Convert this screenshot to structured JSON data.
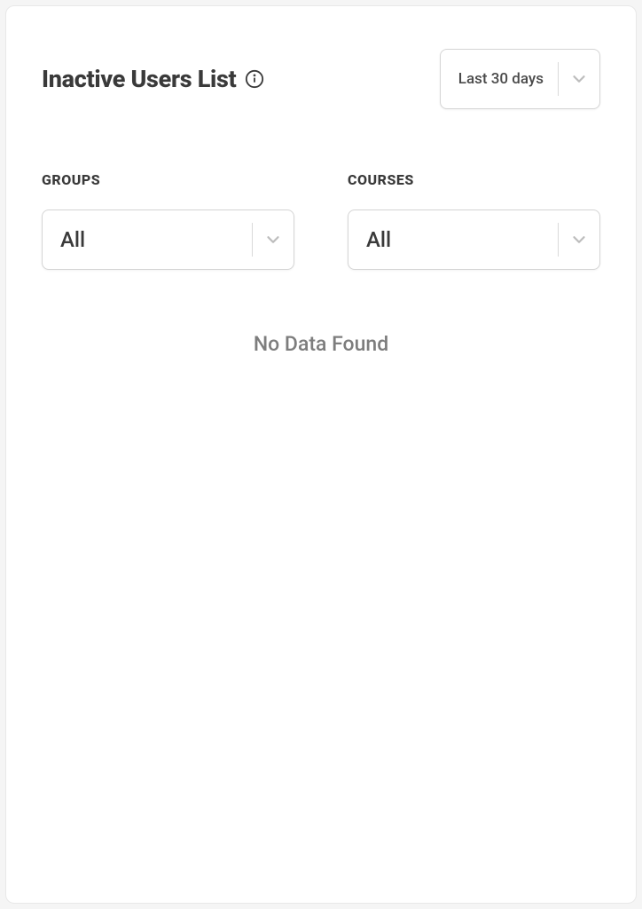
{
  "header": {
    "title": "Inactive Users List",
    "date_range": {
      "selected": "Last 30 days"
    }
  },
  "filters": {
    "groups": {
      "label": "GROUPS",
      "selected": "All"
    },
    "courses": {
      "label": "COURSES",
      "selected": "All"
    }
  },
  "content": {
    "empty_message": "No Data Found"
  }
}
